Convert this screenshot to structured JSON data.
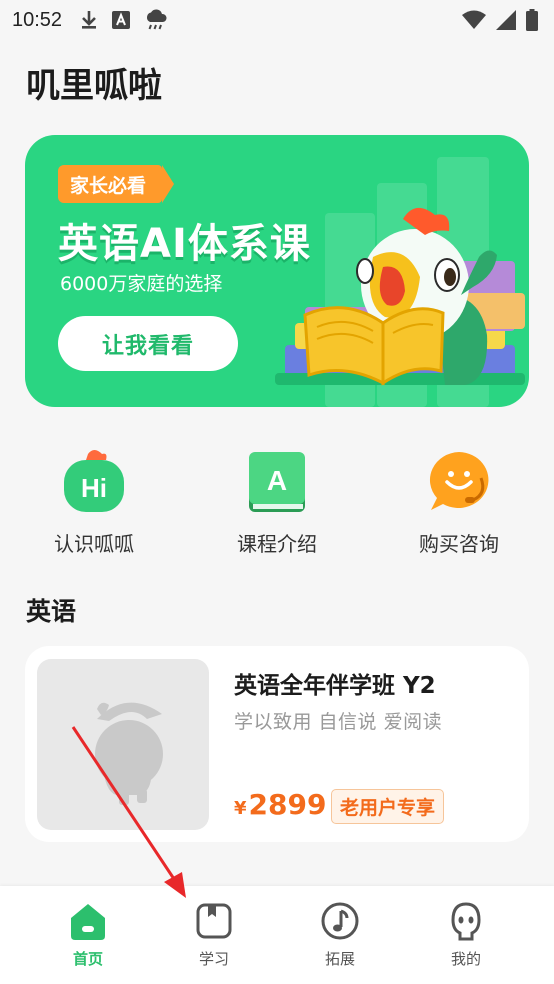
{
  "status_bar": {
    "time": "10:52",
    "left_icons": [
      "download-icon",
      "a-notification-icon",
      "cloud-rain-icon"
    ],
    "right_icons": [
      "wifi-icon",
      "cellular-icon",
      "battery-icon"
    ]
  },
  "app": {
    "title": "叽里呱啦"
  },
  "banner": {
    "tag": "家长必看",
    "title": "英语AI体系课",
    "subtitle": "6000万家庭的选择",
    "button_label": "让我看看",
    "bg_color": "#2ad582",
    "mascot_icon": "parrot-reading-book-illustration"
  },
  "quick_entries": [
    {
      "label": "认识呱呱",
      "icon": "hi-mascot-icon"
    },
    {
      "label": "课程介绍",
      "icon": "book-a-icon"
    },
    {
      "label": "购买咨询",
      "icon": "chat-support-icon"
    }
  ],
  "section": {
    "title": "英语"
  },
  "course": {
    "name": "英语全年伴学班 Y2",
    "description": "学以致用 自信说 爱阅读",
    "currency": "¥",
    "price": "2899",
    "badge": "老用户专享",
    "thumbnail_icon": "mascot-placeholder-icon"
  },
  "tab_bar": {
    "active_color": "#2cbf6d",
    "tabs": [
      {
        "label": "首页",
        "icon": "home-icon",
        "active": true
      },
      {
        "label": "学习",
        "icon": "study-book-icon",
        "active": false
      },
      {
        "label": "拓展",
        "icon": "music-note-icon",
        "active": false
      },
      {
        "label": "我的",
        "icon": "profile-face-icon",
        "active": false
      }
    ]
  }
}
